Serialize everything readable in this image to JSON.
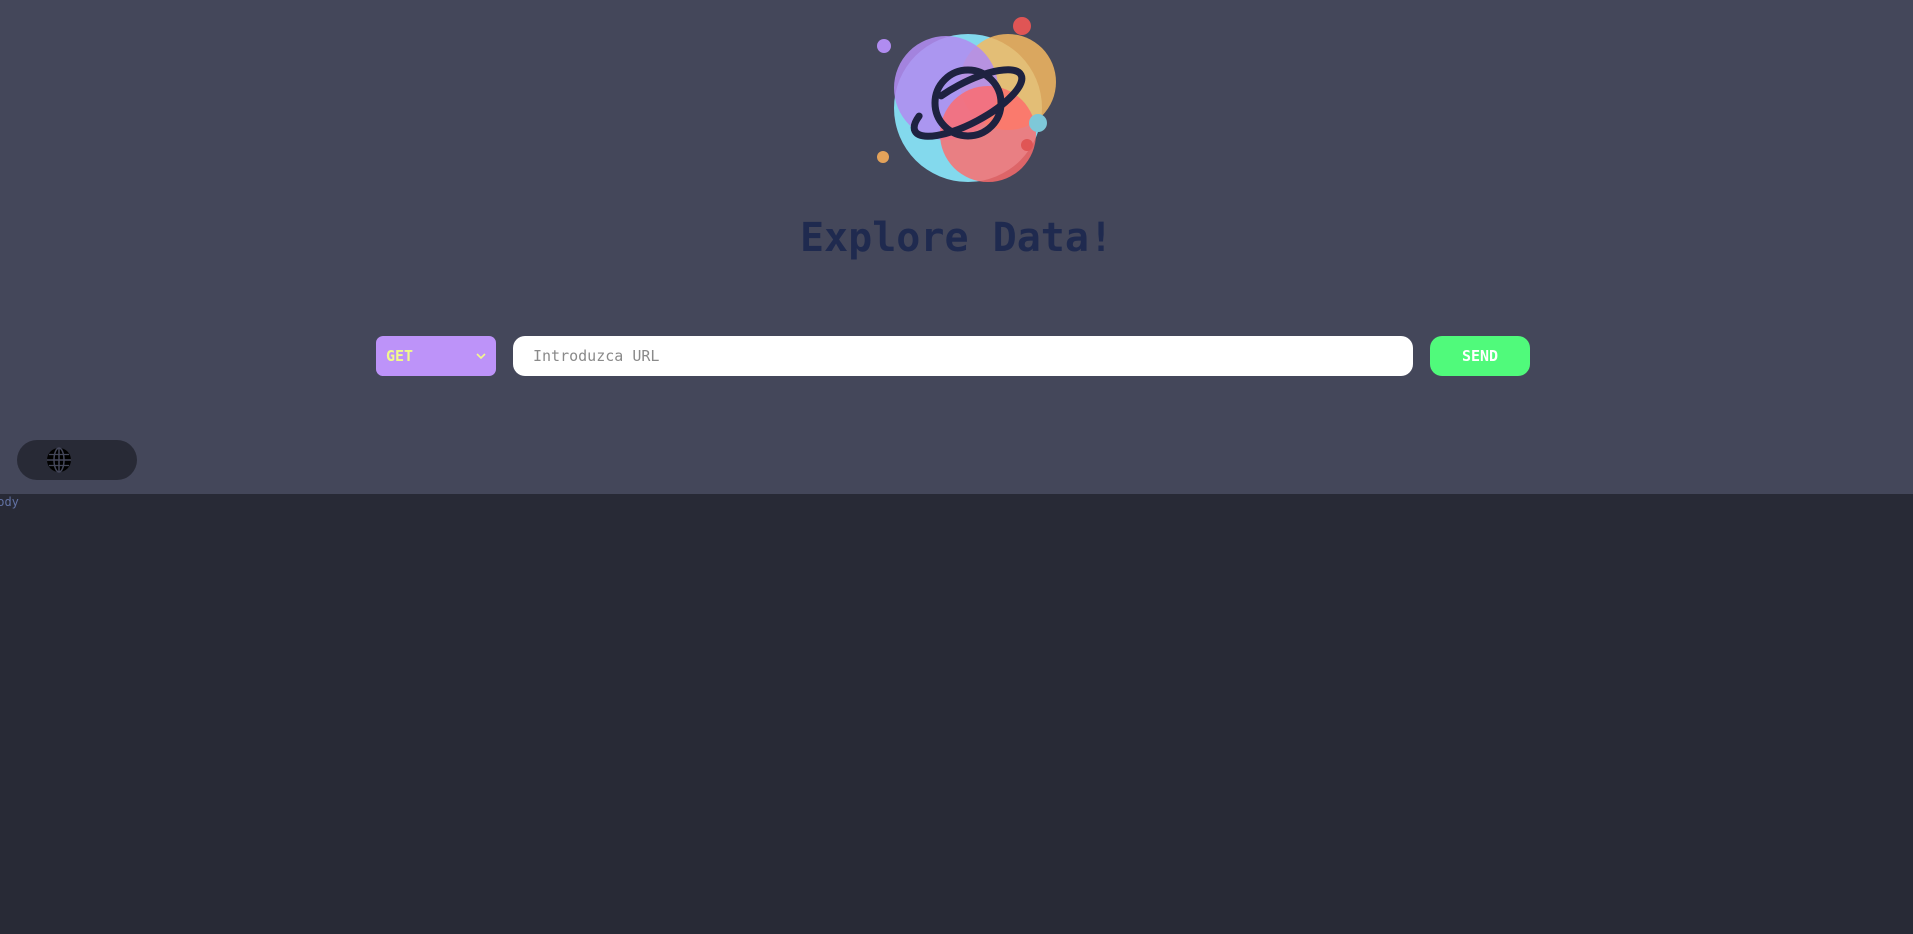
{
  "header": {
    "logo_icon": "planet-logo-icon",
    "title": "Explore Data!"
  },
  "request": {
    "method": "GET",
    "url_value": "",
    "url_placeholder": "Introduzca URL",
    "send_label": "SEND"
  },
  "language_toggle": {
    "icon": "globe-icon"
  },
  "response": {
    "body_label": "body"
  },
  "colors": {
    "top_panel_bg": "#44475a",
    "page_bg": "#282a36",
    "title_color": "#1f2a4f",
    "method_bg": "#bd93f9",
    "method_text": "#f1fa8c",
    "send_bg": "#50fa7b",
    "body_label": "#6272a4"
  }
}
